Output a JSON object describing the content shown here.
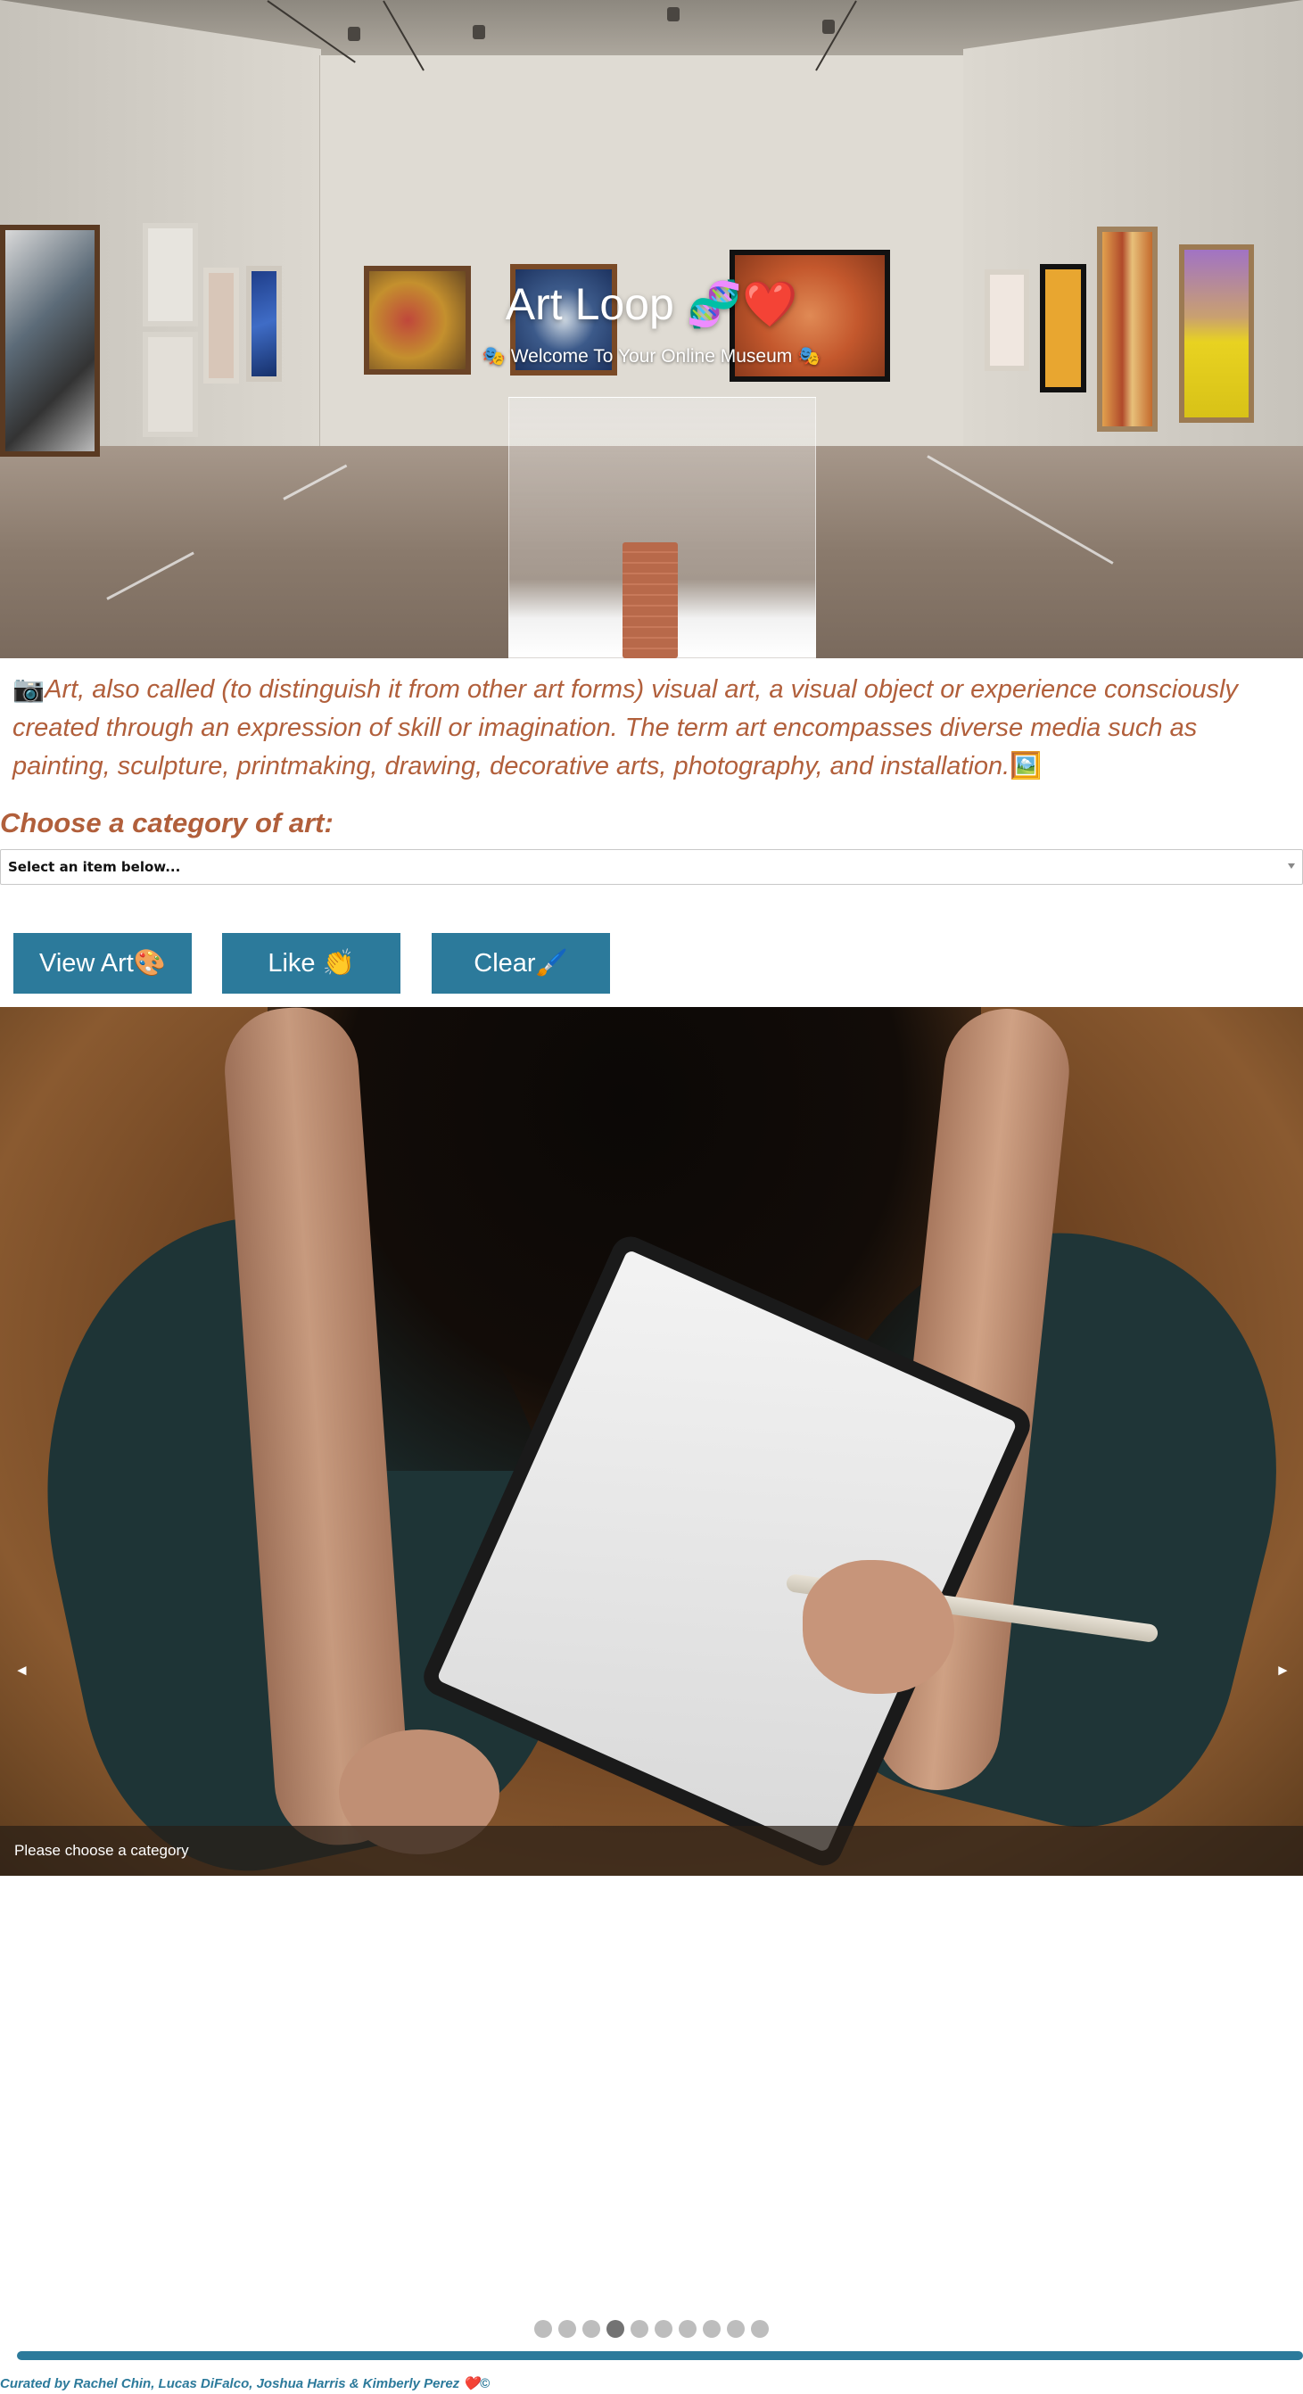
{
  "hero": {
    "title": "Art Loop 🧬❤️",
    "subtitle": "🎭 Welcome To Your Online Museum 🎭"
  },
  "description": {
    "lead_icon": "📷",
    "text": "Art, also called (to distinguish it from other art forms) visual art, a visual object or experience consciously created through an expression of skill or imagination. The term art encompasses diverse media such as painting, sculpture, printmaking, drawing, decorative arts, photography, and installation.",
    "trail_icon": "🖼️"
  },
  "category": {
    "label": "Choose a category of art:",
    "selected": "Select an item below..."
  },
  "buttons": {
    "view_art": "View Art🎨",
    "like": "Like 👏",
    "clear": "Clear🖌️"
  },
  "carousel": {
    "caption": "Please choose a category",
    "prev_symbol": "◄",
    "next_symbol": "►",
    "slide_count": 10,
    "active_slide": 4
  },
  "footer": {
    "credits": "Curated by Rachel Chin, Lucas DiFalco, Joshua Harris & Kimberly Perez ❤️©"
  },
  "colors": {
    "accent": "#2c7a9b",
    "text_brown": "#b15f3b"
  }
}
